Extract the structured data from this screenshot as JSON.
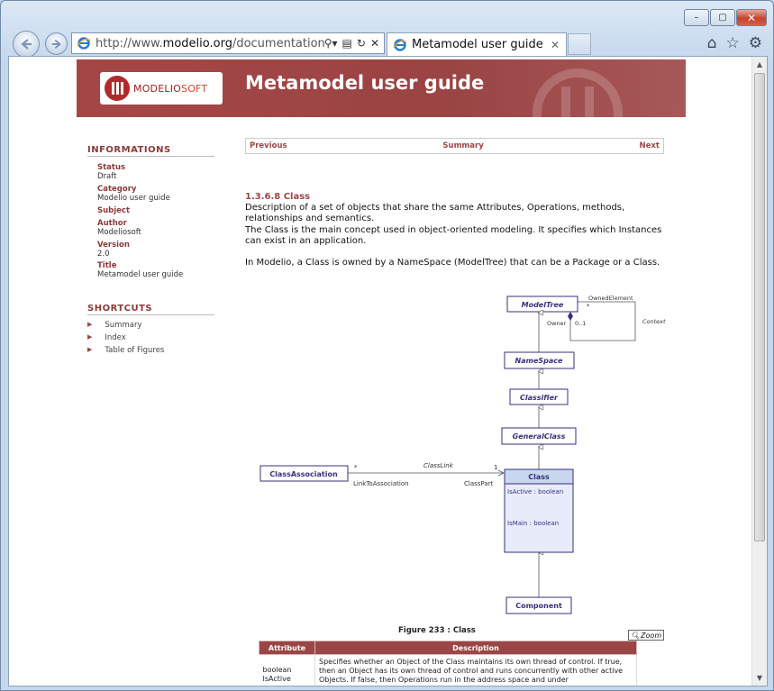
{
  "browser": {
    "url_prefix": "http://www.",
    "url_domain": "modelio.org",
    "url_rest": "/documentation/m",
    "tab_title": "Metamodel user guide",
    "window_controls": {
      "minimize": "–",
      "maximize": "▢",
      "close": "✕"
    },
    "icons": [
      "back-arrow-icon",
      "forward-arrow-icon",
      "ie-logo-icon",
      "search-icon",
      "compatibility-icon",
      "refresh-icon",
      "stop-icon",
      "home-icon",
      "favorites-star-icon",
      "gear-icon"
    ]
  },
  "header": {
    "logo_text_main": "MODELIO",
    "logo_text_light": "SOFT",
    "title": "Metamodel user guide"
  },
  "sidebar": {
    "informations_title": "INFORMATIONS",
    "fields": [
      {
        "label": "Status",
        "value": "Draft"
      },
      {
        "label": "Category",
        "value": "Modelio user guide"
      },
      {
        "label": "Subject",
        "value": ""
      },
      {
        "label": "Author",
        "value": "Modeliosoft"
      },
      {
        "label": "Version",
        "value": "2.0"
      },
      {
        "label": "Title",
        "value": "Metamodel user guide"
      }
    ],
    "shortcuts_title": "SHORTCUTS",
    "shortcuts": [
      "Summary",
      "Index",
      "Table of Figures"
    ]
  },
  "page_nav": {
    "previous": "Previous",
    "summary": "Summary",
    "next": "Next"
  },
  "content": {
    "section_title": "1.3.6.8 Class",
    "para1": "Description of a set of objects that share the same Attributes, Operations, methods, relationships and semantics.",
    "para2": "The Class is the main concept used in object-oriented modeling. It specifies which Instances can exist in an application.",
    "para3": "In Modelio, a Class is owned by a NameSpace (ModelTree) that can be a Package or a Class."
  },
  "diagram": {
    "classes": {
      "modeltree": "ModelTree",
      "namespace": "NameSpace",
      "classifier": "Classifier",
      "generalclass": "GeneralClass",
      "class": "Class",
      "component": "Component",
      "classassociation": "ClassAssociation"
    },
    "attributes": [
      "IsActive : boolean",
      "IsMain : boolean"
    ],
    "labels": {
      "owned_element": "OwnedElement",
      "star1": "*",
      "owner": "Owner",
      "mult_01": "0..1",
      "context": "Context",
      "classlink": "ClassLink",
      "star2": "*",
      "one": "1",
      "link_to_assoc": "LinkToAssociation",
      "class_part": "ClassPart"
    },
    "caption": "Figure 233 : Class",
    "zoom": "Zoom"
  },
  "attr_table": {
    "headers": [
      "Attribute",
      "Description"
    ],
    "row_attribute": "boolean\nIsActive",
    "row_description": "Specifies whether an Object of the Class maintains its own thread of control. If true, then an Object has its own thread of control and runs concurrently with other active Objects. If false, then Operations run in the address space and under"
  }
}
